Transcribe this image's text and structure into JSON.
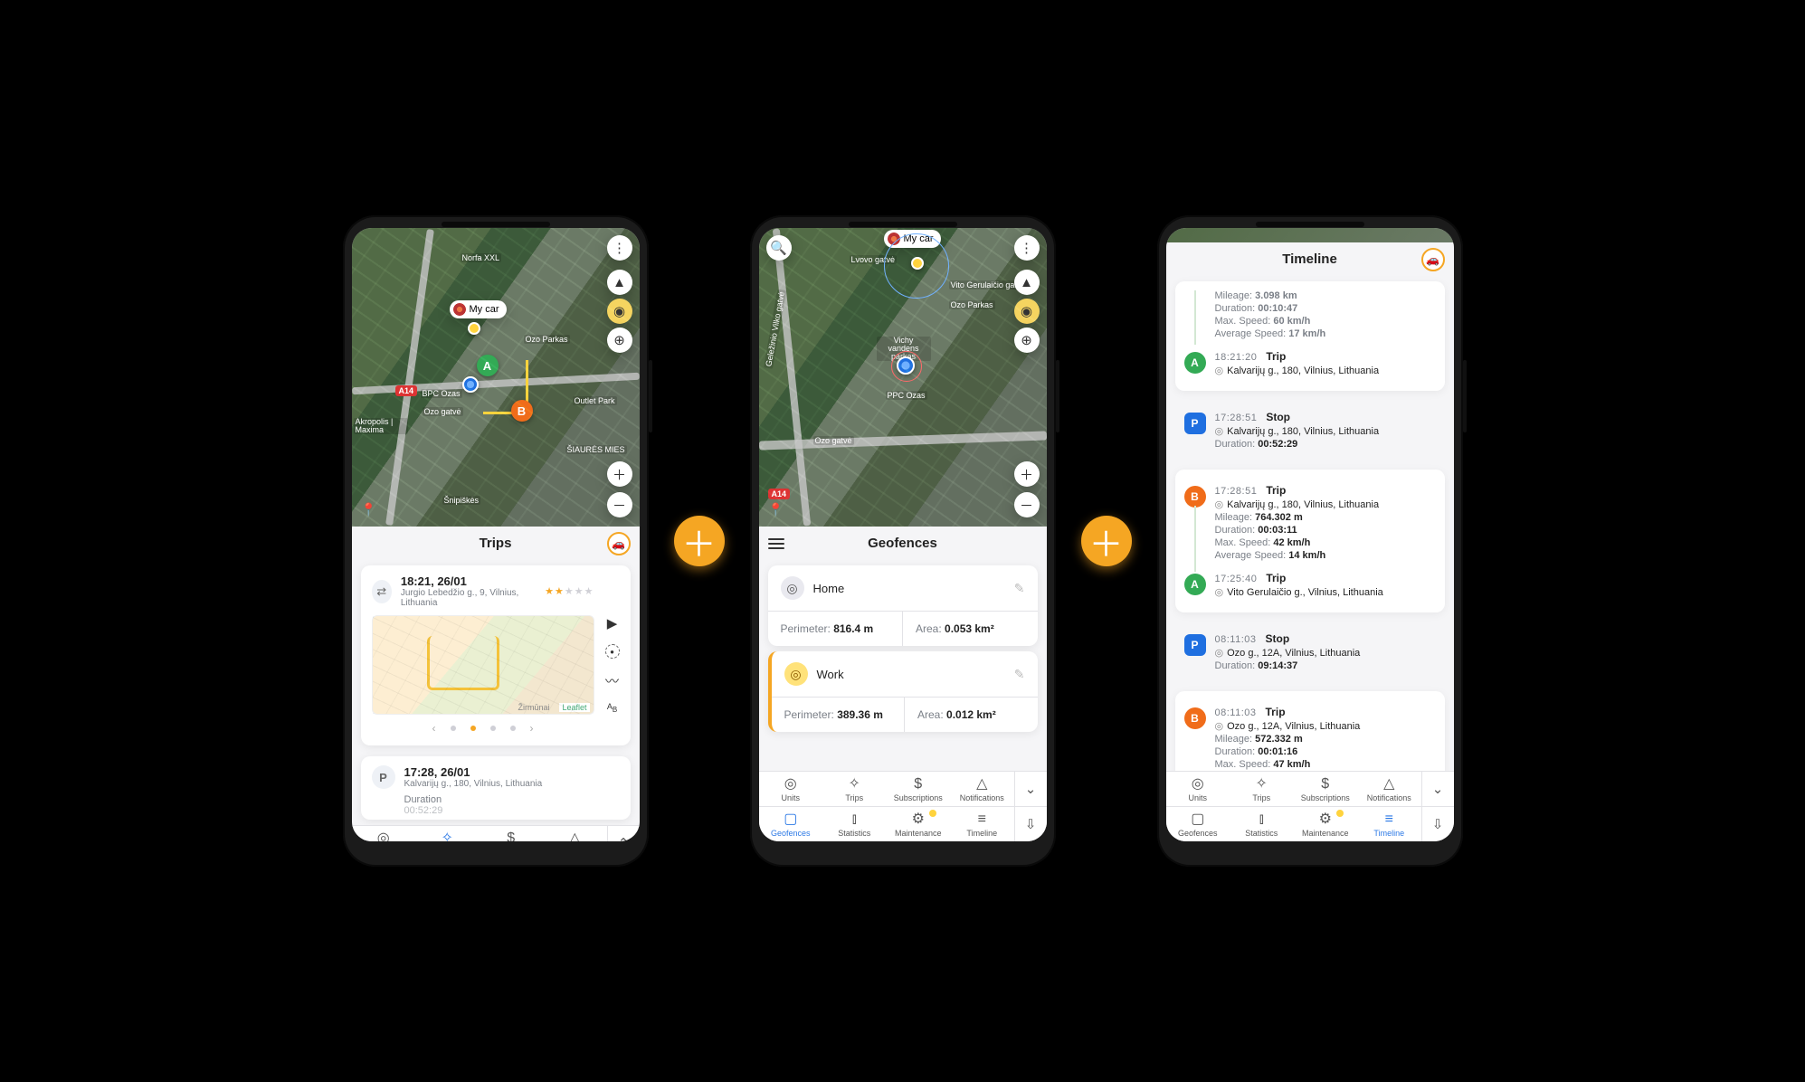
{
  "separator_glyph": "＋",
  "phone1": {
    "car_label": "My car",
    "map": {
      "labels": [
        "Norfa XXL",
        "Ozo Parkas",
        "BPC Ozas",
        "Akropolis | Maxima",
        "Outlet Park",
        "ŠIAURĖS MIES",
        "Šnipiškės",
        "Ozo gatvė"
      ],
      "shield": "A14",
      "markers": {
        "A": "A",
        "B": "B"
      }
    },
    "panel_title": "Trips",
    "trip": {
      "time": "18:21, 26/01",
      "address": "Jurgio Lebedžio g., 9, Vilnius, Lithuania",
      "stars_on": 2,
      "stars_total": 5,
      "minimap_credit": "Leaflet",
      "minimap_label": "Žirmūnai",
      "ab_label": "A\nB"
    },
    "trip2": {
      "time": "17:28, 26/01",
      "address": "Kalvarijų g., 180, Vilnius, Lithuania",
      "duration_label": "Duration",
      "duration_value": "00:52:29"
    },
    "nav": {
      "row1": [
        {
          "label": "Units",
          "icon": "◎",
          "active": false
        },
        {
          "label": "Trips",
          "icon": "✧",
          "active": true
        },
        {
          "label": "Subscriptions",
          "icon": "$",
          "active": false
        },
        {
          "label": "Notifications",
          "icon": "△",
          "active": false
        }
      ],
      "side": "⌃"
    }
  },
  "phone2": {
    "car_label": "My car",
    "map": {
      "labels": [
        "Geležinio Vilko gatvė",
        "Ozo gatvė",
        "Ozo Parkas",
        "Vichy vandens parkas",
        "PPC Ozas",
        "Vito Gerulaičio gatvė",
        "Lvovo gatvė"
      ],
      "shield": "A14"
    },
    "panel_title": "Geofences",
    "geofences": [
      {
        "name": "Home",
        "perimeter_label": "Perimeter:",
        "perimeter": "816.4 m",
        "area_label": "Area:",
        "area": "0.053 km²",
        "selected": false
      },
      {
        "name": "Work",
        "perimeter_label": "Perimeter:",
        "perimeter": "389.36 m",
        "area_label": "Area:",
        "area": "0.012 km²",
        "selected": true
      }
    ],
    "nav": {
      "row1": [
        {
          "label": "Units",
          "icon": "◎"
        },
        {
          "label": "Trips",
          "icon": "✧"
        },
        {
          "label": "Subscriptions",
          "icon": "$"
        },
        {
          "label": "Notifications",
          "icon": "△"
        }
      ],
      "row2": [
        {
          "label": "Geofences",
          "icon": "▢",
          "active": true
        },
        {
          "label": "Statistics",
          "icon": "⫾",
          "active": false
        },
        {
          "label": "Maintenance",
          "icon": "⚙",
          "active": false,
          "blip": true
        },
        {
          "label": "Timeline",
          "icon": "≡",
          "active": false
        }
      ],
      "side1": "⌄",
      "side2": "⇩"
    }
  },
  "phone3": {
    "panel_title": "Timeline",
    "top_clip": [
      {
        "k": "Mileage:",
        "v": "3.098 km"
      },
      {
        "k": "Duration:",
        "v": "00:10:47"
      },
      {
        "k": "Max. Speed:",
        "v": "60 km/h"
      },
      {
        "k": "Average Speed:",
        "v": "17 km/h"
      }
    ],
    "events": [
      {
        "marker": "A",
        "time": "18:21:20",
        "label": "Trip",
        "loc": "Kalvarijų g., 180, Vilnius, Lithuania",
        "details": [],
        "card_end": true
      },
      {
        "marker": "P",
        "time": "17:28:51",
        "label": "Stop",
        "loc": "Kalvarijų g., 180, Vilnius, Lithuania",
        "details": [
          {
            "k": "Duration:",
            "v": "00:52:29"
          }
        ],
        "standalone": true
      },
      {
        "marker": "B",
        "time": "17:28:51",
        "label": "Trip",
        "loc": "Kalvarijų g., 180, Vilnius, Lithuania",
        "details": [
          {
            "k": "Mileage:",
            "v": "764.302 m"
          },
          {
            "k": "Duration:",
            "v": "00:03:11"
          },
          {
            "k": "Max. Speed:",
            "v": "42 km/h"
          },
          {
            "k": "Average Speed:",
            "v": "14 km/h"
          }
        ]
      },
      {
        "marker": "A",
        "time": "17:25:40",
        "label": "Trip",
        "loc": "Vito Gerulaičio g., Vilnius, Lithuania",
        "details": [],
        "card_end": true
      },
      {
        "marker": "P",
        "time": "08:11:03",
        "label": "Stop",
        "loc": "Ozo g., 12A, Vilnius, Lithuania",
        "details": [
          {
            "k": "Duration:",
            "v": "09:14:37"
          }
        ],
        "standalone": true
      },
      {
        "marker": "B",
        "time": "08:11:03",
        "label": "Trip",
        "loc": "Ozo g., 12A, Vilnius, Lithuania",
        "details": [
          {
            "k": "Mileage:",
            "v": "572.332 m"
          },
          {
            "k": "Duration:",
            "v": "00:01:16"
          },
          {
            "k": "Max. Speed:",
            "v": "47 km/h"
          }
        ],
        "clipped": true
      }
    ],
    "nav": {
      "row1": [
        {
          "label": "Units",
          "icon": "◎"
        },
        {
          "label": "Trips",
          "icon": "✧"
        },
        {
          "label": "Subscriptions",
          "icon": "$"
        },
        {
          "label": "Notifications",
          "icon": "△"
        }
      ],
      "row2": [
        {
          "label": "Geofences",
          "icon": "▢",
          "active": false
        },
        {
          "label": "Statistics",
          "icon": "⫾",
          "active": false
        },
        {
          "label": "Maintenance",
          "icon": "⚙",
          "active": false,
          "blip": true
        },
        {
          "label": "Timeline",
          "icon": "≡",
          "active": true
        }
      ],
      "side1": "⌄",
      "side2": "⇩"
    }
  }
}
